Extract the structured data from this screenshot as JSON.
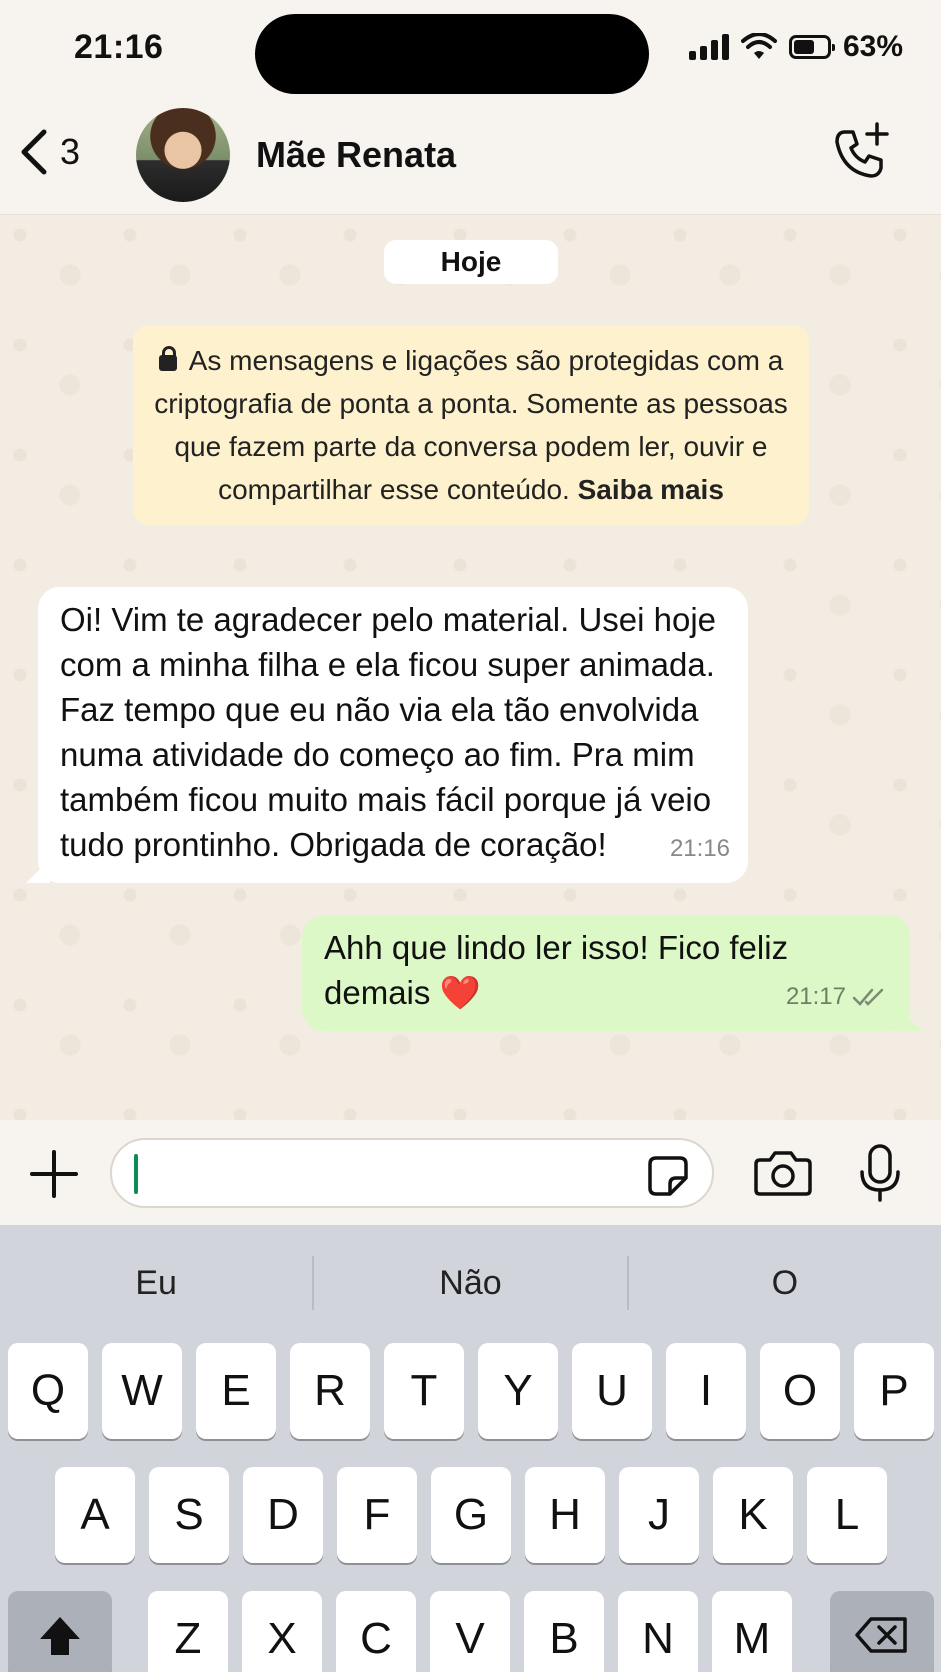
{
  "status_bar": {
    "time": "21:16",
    "battery_percent": "63%",
    "battery_level": 0.63
  },
  "header": {
    "back_count": "3",
    "contact_name": "Mãe Renata"
  },
  "chat": {
    "date_chip": "Hoje",
    "encryption_notice": {
      "text": "As mensagens e ligações são protegidas com a criptografia de ponta a ponta. Somente as pessoas que fazem parte da conversa podem ler, ouvir e compartilhar esse conteúdo.",
      "link": "Saiba mais"
    },
    "messages": [
      {
        "direction": "incoming",
        "text": "Oi! Vim te agradecer pelo material. Usei hoje com a minha filha e ela ficou super animada. Faz tempo que eu não via ela tão envolvida numa atividade do começo ao fim. Pra mim também ficou muito mais fácil porque já veio tudo prontinho. Obrigada de coração!",
        "time": "21:16"
      },
      {
        "direction": "outgoing",
        "text": "Ahh que lindo ler isso! Fico feliz demais",
        "emoji": "❤️",
        "time": "21:17",
        "status": "read"
      }
    ]
  },
  "input_bar": {
    "message_value": ""
  },
  "keyboard": {
    "suggestions": [
      "Eu",
      "Não",
      "O"
    ],
    "row1": [
      "Q",
      "W",
      "E",
      "R",
      "T",
      "Y",
      "U",
      "I",
      "O",
      "P"
    ],
    "row2": [
      "A",
      "S",
      "D",
      "F",
      "G",
      "H",
      "J",
      "K",
      "L"
    ],
    "row3": [
      "Z",
      "X",
      "C",
      "V",
      "B",
      "N",
      "M"
    ]
  }
}
